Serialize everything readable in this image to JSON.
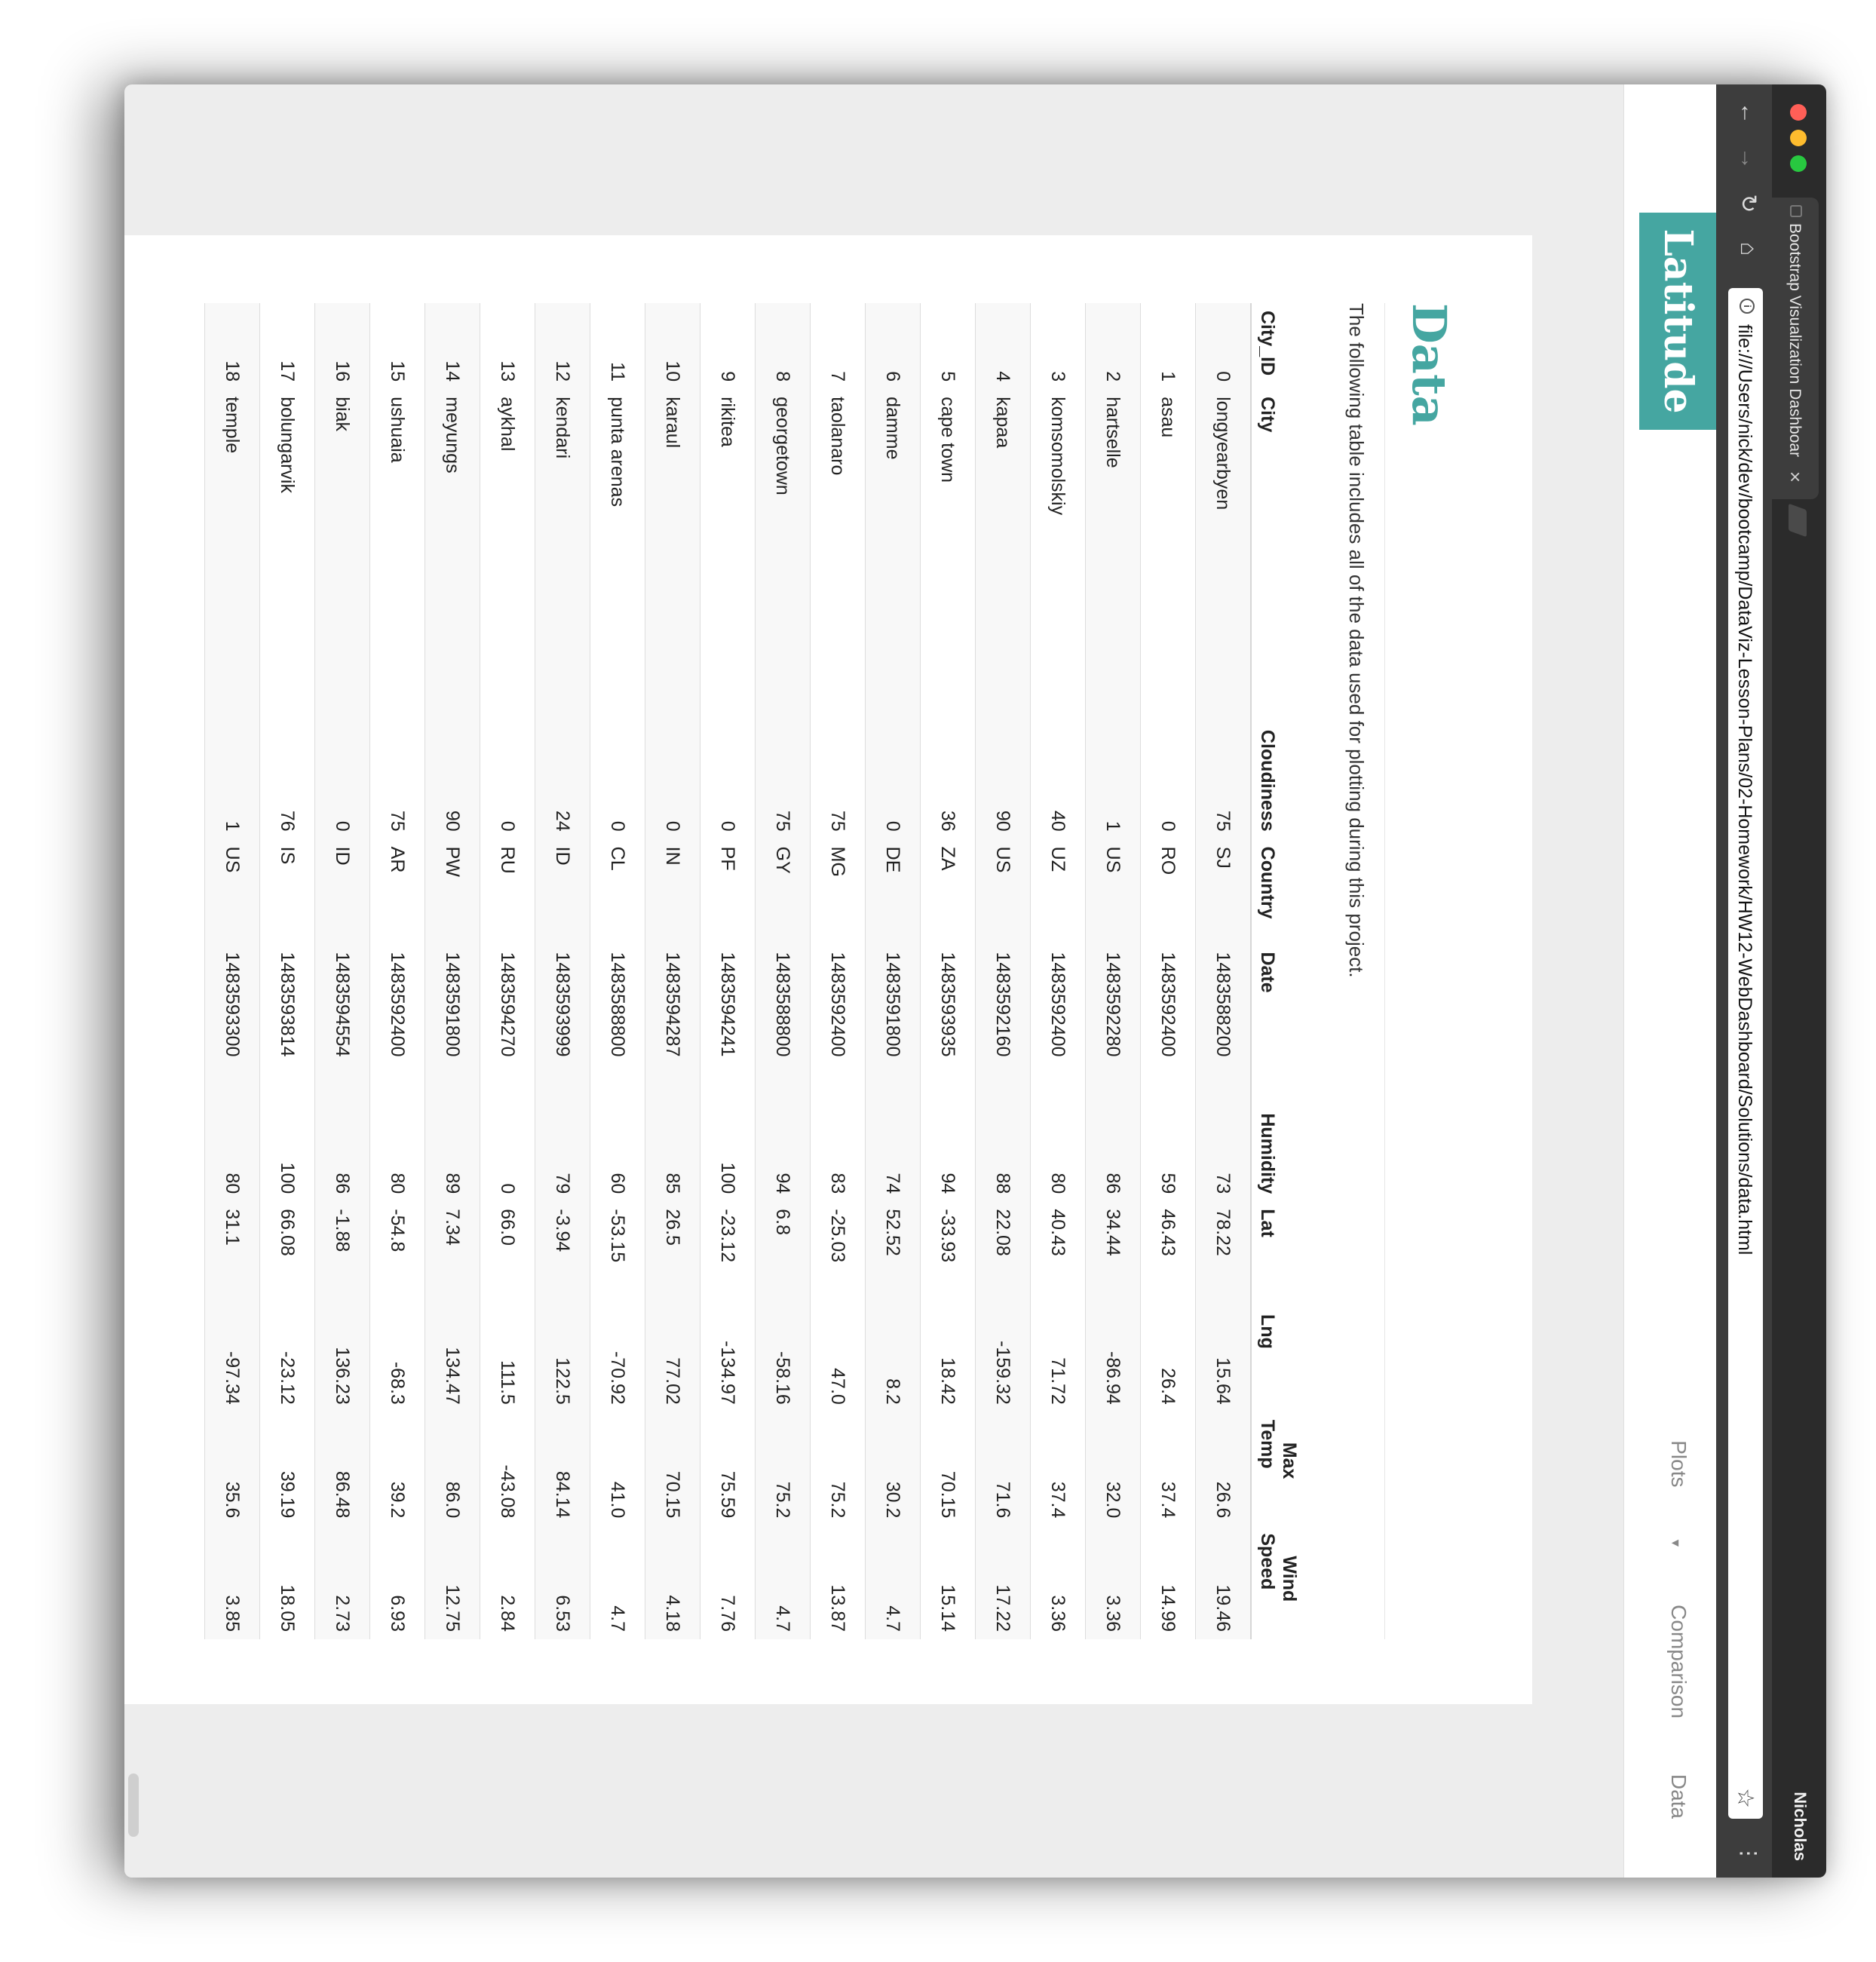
{
  "browser": {
    "tab_title": "Bootstrap Visualization Dashboard",
    "tab_close": "×",
    "url": "file:///Users/nick/dev/bootcamp/DataViz-Lesson-Plans/02-Homework/HW12-WebDashboard/Solutions/data.html",
    "profile_name": "Nicholas",
    "traffic_lights": {
      "close": "#ff5f57",
      "minimize": "#febc2e",
      "zoom": "#28c840"
    },
    "icons": {
      "back": "arrow-left-icon",
      "forward": "arrow-right-icon",
      "reload": "reload-icon",
      "home": "home-icon",
      "info": "info-icon",
      "bookmark": "star-icon",
      "menu": "more-icon"
    }
  },
  "navbar": {
    "brand": "Latitude",
    "links": [
      {
        "label": "Plots",
        "dropdown": true
      },
      {
        "label": "Comparison",
        "dropdown": false
      },
      {
        "label": "Data",
        "dropdown": false
      }
    ],
    "accent_color": "#45a6a1"
  },
  "page": {
    "title": "Data",
    "description": "The following table includes all of the data used for plotting during this project."
  },
  "table": {
    "headers": {
      "city_id": "City_ID",
      "city": "City",
      "cloudiness": "Cloudiness",
      "country": "Country",
      "date": "Date",
      "humidity": "Humidity",
      "lat": "Lat",
      "lng": "Lng",
      "max_temp_1": "Max",
      "max_temp_2": "Temp",
      "wind_speed_1": "Wind",
      "wind_speed_2": "Speed"
    },
    "rows": [
      [
        "0",
        "longyearbyen",
        "75",
        "SJ",
        "1483588200",
        "73",
        "78.22",
        "15.64",
        "26.6",
        "19.46"
      ],
      [
        "1",
        "asau",
        "0",
        "RO",
        "1483592400",
        "59",
        "46.43",
        "26.4",
        "37.4",
        "14.99"
      ],
      [
        "2",
        "hartselle",
        "1",
        "US",
        "1483592280",
        "86",
        "34.44",
        "-86.94",
        "32.0",
        "3.36"
      ],
      [
        "3",
        "komsomolskiy",
        "40",
        "UZ",
        "1483592400",
        "80",
        "40.43",
        "71.72",
        "37.4",
        "3.36"
      ],
      [
        "4",
        "kapaa",
        "90",
        "US",
        "1483592160",
        "88",
        "22.08",
        "-159.32",
        "71.6",
        "17.22"
      ],
      [
        "5",
        "cape town",
        "36",
        "ZA",
        "1483593935",
        "94",
        "-33.93",
        "18.42",
        "70.15",
        "15.14"
      ],
      [
        "6",
        "damme",
        "0",
        "DE",
        "1483591800",
        "74",
        "52.52",
        "8.2",
        "30.2",
        "4.7"
      ],
      [
        "7",
        "taolanaro",
        "75",
        "MG",
        "1483592400",
        "83",
        "-25.03",
        "47.0",
        "75.2",
        "13.87"
      ],
      [
        "8",
        "georgetown",
        "75",
        "GY",
        "1483588800",
        "94",
        "6.8",
        "-58.16",
        "75.2",
        "4.7"
      ],
      [
        "9",
        "rikitea",
        "0",
        "PF",
        "1483594241",
        "100",
        "-23.12",
        "-134.97",
        "75.59",
        "7.76"
      ],
      [
        "10",
        "karaul",
        "0",
        "IN",
        "1483594287",
        "85",
        "26.5",
        "77.02",
        "70.15",
        "4.18"
      ],
      [
        "11",
        "punta arenas",
        "0",
        "CL",
        "1483588800",
        "60",
        "-53.15",
        "-70.92",
        "41.0",
        "4.7"
      ],
      [
        "12",
        "kendari",
        "24",
        "ID",
        "1483593999",
        "79",
        "-3.94",
        "122.5",
        "84.14",
        "6.53"
      ],
      [
        "13",
        "aykhal",
        "0",
        "RU",
        "1483594270",
        "0",
        "66.0",
        "111.5",
        "-43.08",
        "2.84"
      ],
      [
        "14",
        "meyungs",
        "90",
        "PW",
        "1483591800",
        "89",
        "7.34",
        "134.47",
        "86.0",
        "12.75"
      ],
      [
        "15",
        "ushuaia",
        "75",
        "AR",
        "1483592400",
        "80",
        "-54.8",
        "-68.3",
        "39.2",
        "6.93"
      ],
      [
        "16",
        "biak",
        "0",
        "ID",
        "1483594554",
        "86",
        "-1.88",
        "136.23",
        "86.48",
        "2.73"
      ],
      [
        "17",
        "bolungarvik",
        "76",
        "IS",
        "1483593814",
        "100",
        "66.08",
        "-23.12",
        "39.19",
        "18.05"
      ],
      [
        "18",
        "temple",
        "1",
        "US",
        "1483593300",
        "80",
        "31.1",
        "-97.34",
        "35.6",
        "3.85"
      ]
    ]
  }
}
